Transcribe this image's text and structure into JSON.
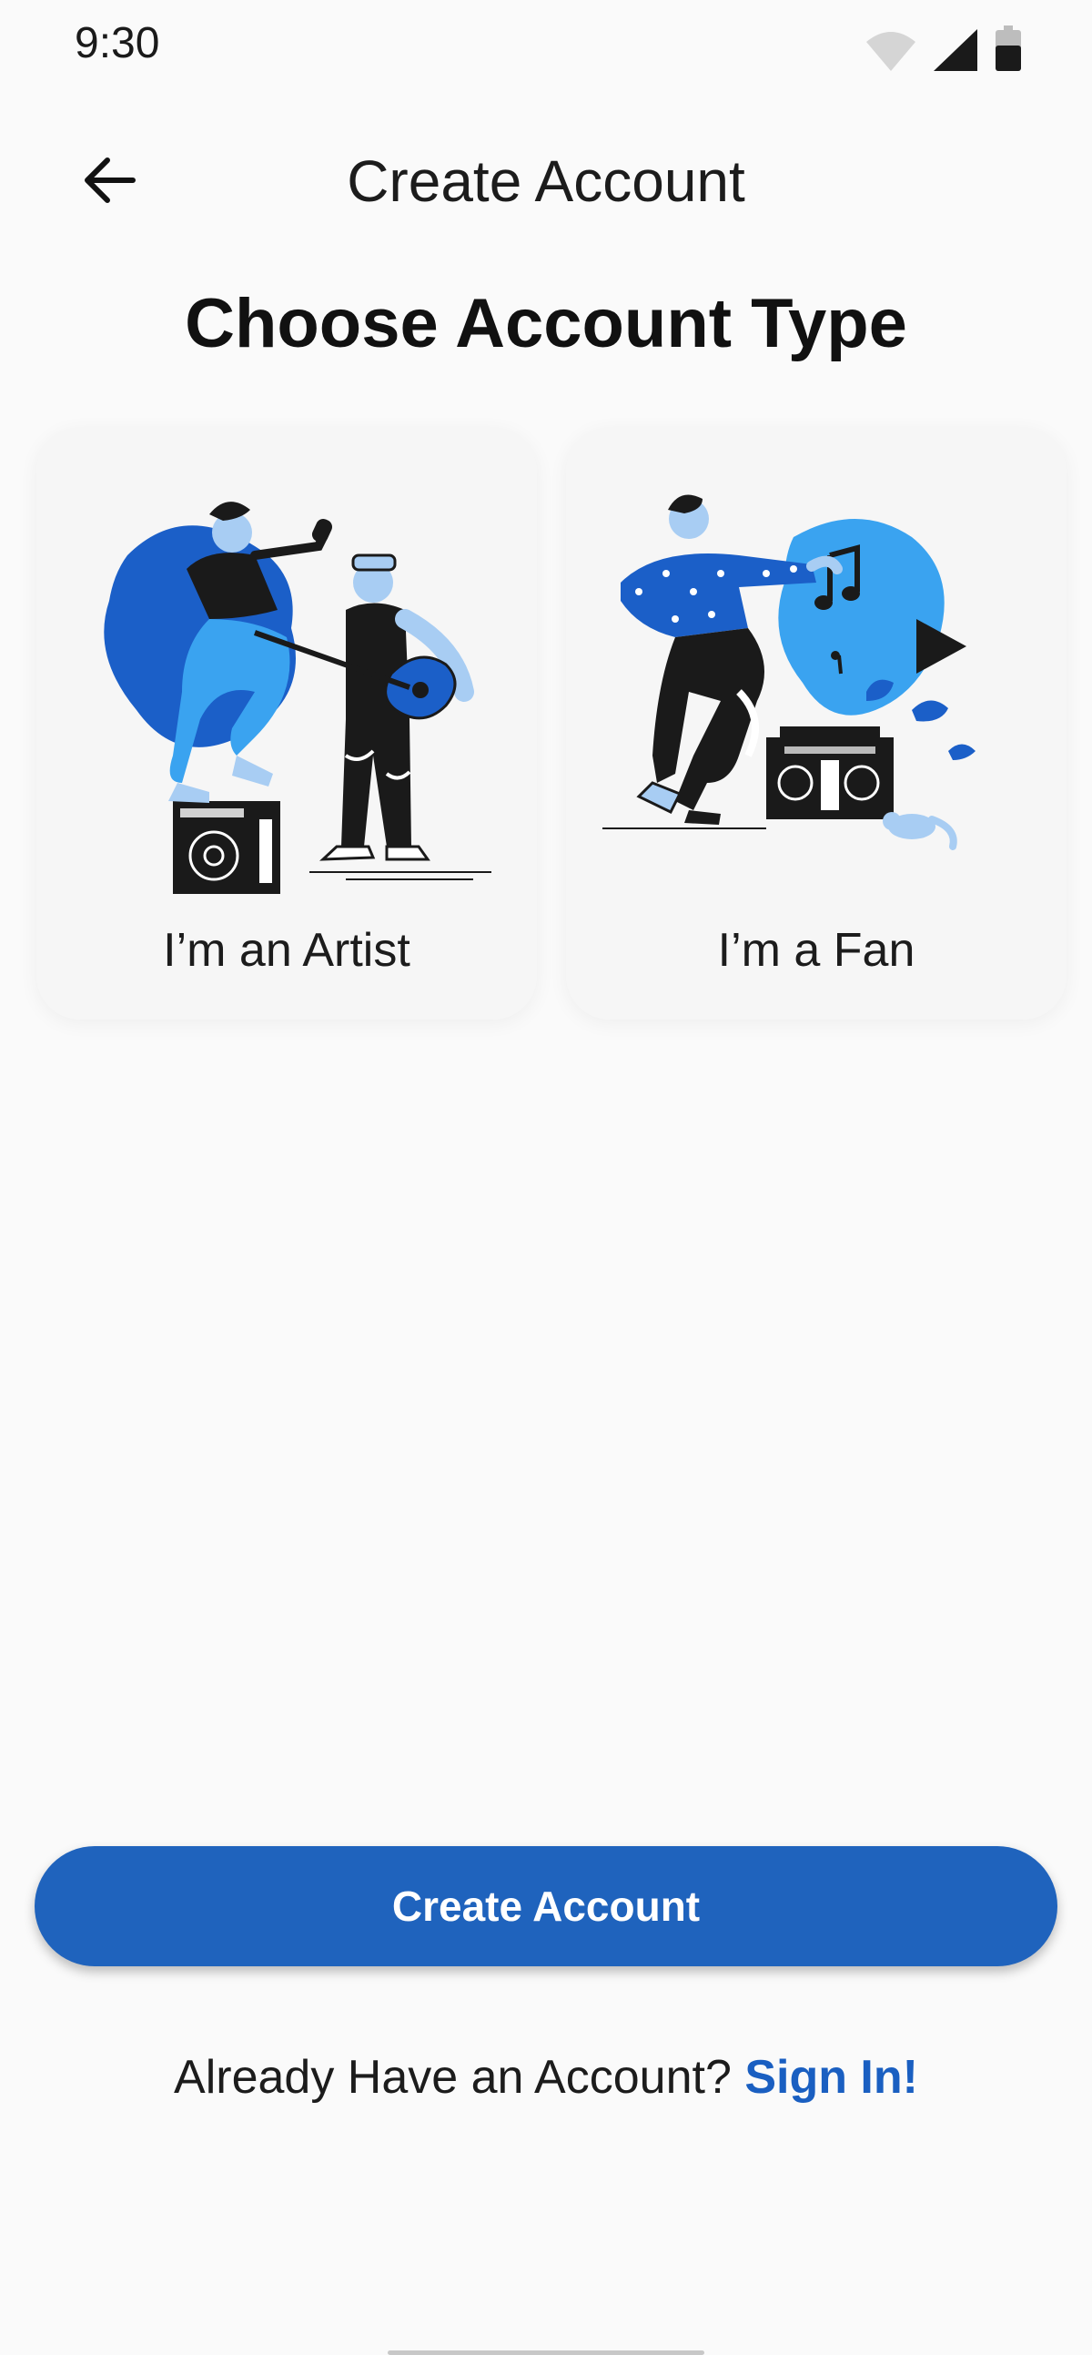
{
  "status_bar": {
    "time": "9:30",
    "icons": [
      "wifi-icon",
      "cellular-signal-icon",
      "battery-icon"
    ]
  },
  "app_bar": {
    "back_icon": "arrow-left-icon",
    "title": "Create Account"
  },
  "heading": "Choose Account Type",
  "account_types": [
    {
      "label": "I’m an Artist",
      "illustration": "artist-illustration"
    },
    {
      "label": "I’m a Fan",
      "illustration": "fan-illustration"
    }
  ],
  "primary_button": {
    "label": "Create Account"
  },
  "signin": {
    "prompt": "Already Have an Account? ",
    "link": "Sign In!"
  },
  "colors": {
    "primary": "#1f63bd",
    "link": "#1a5fc1",
    "illustration_blue": "#1b5fc8",
    "illustration_light_blue": "#3aa3f0",
    "illustration_pale_blue": "#a8cdf3",
    "background": "#fafafa"
  }
}
